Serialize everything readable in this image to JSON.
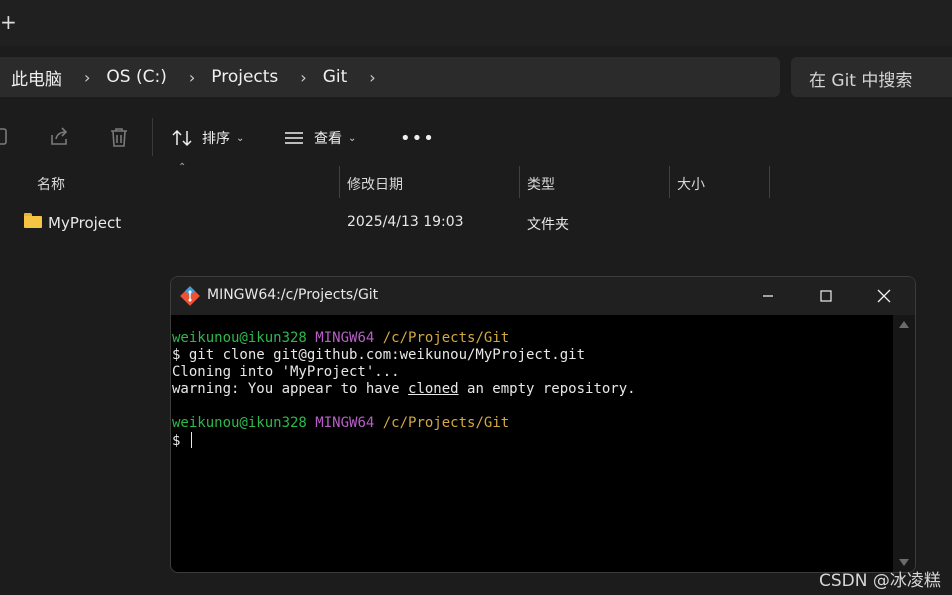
{
  "tabstrip": {
    "new_tab_glyph": "+"
  },
  "breadcrumb": [
    "此电脑",
    "OS (C:)",
    "Projects",
    "Git"
  ],
  "breadcrumb_separator": "›",
  "search": {
    "placeholder": "在 Git 中搜索"
  },
  "toolbar": {
    "icons": [
      "pane-icon",
      "share-icon",
      "delete-icon"
    ],
    "sort_label": "排序",
    "view_label": "查看",
    "more_label": "•••"
  },
  "columns": {
    "name": "名称",
    "date": "修改日期",
    "type": "类型",
    "size": "大小"
  },
  "files": [
    {
      "name": "MyProject",
      "date": "2025/4/13 19:03",
      "type": "文件夹",
      "size": ""
    }
  ],
  "terminal": {
    "title": "MINGW64:/c/Projects/Git",
    "prompt": {
      "user": "weikunou@ikun328",
      "env": "MINGW64",
      "path": "/c/Projects/Git"
    },
    "command": "$ git clone git@github.com:weikunou/MyProject.git",
    "output1": "Cloning into 'MyProject'...",
    "warn_pre": "warning: You appear to have ",
    "warn_u": "cloned",
    "warn_post": " an empty repository.",
    "prompt_symbol": "$ "
  },
  "watermark": "CSDN @冰凌糕",
  "colors": {
    "user_green": "#2db84d",
    "env_magenta": "#b85fc7",
    "path_yellow": "#d2a944",
    "folder_yellow": "#f6c443"
  }
}
